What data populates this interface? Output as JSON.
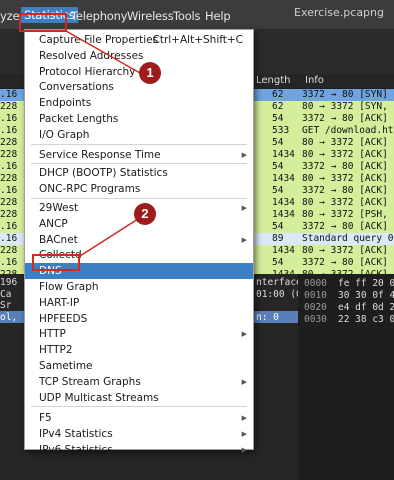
{
  "window": {
    "title": "Exercise.pcapng"
  },
  "menubar": {
    "items": [
      "yze",
      "Statistics",
      "Telephony",
      "Wireless",
      "Tools",
      "Help"
    ]
  },
  "packet_list": {
    "col_length": "Length",
    "col_info": "Info",
    "rows": [
      {
        "left": ".16",
        "len": "62",
        "info": "3372 → 80 [SYN]",
        "color": "#6fa4e0"
      },
      {
        "left": "228",
        "len": "62",
        "info": "80 → 3372 [SYN,",
        "color": "#d4ee9c"
      },
      {
        "left": ".16",
        "len": "54",
        "info": "3372 → 80 [ACK]",
        "color": "#d4ee9c"
      },
      {
        "left": ".16",
        "len": "533",
        "info": "GET /download.ht",
        "color": "#d4ee9c"
      },
      {
        "left": "228",
        "len": "54",
        "info": "80 → 3372 [ACK]",
        "color": "#d4ee9c"
      },
      {
        "left": "228",
        "len": "1434",
        "info": "80 → 3372 [ACK]",
        "color": "#d4ee9c"
      },
      {
        "left": ".16",
        "len": "54",
        "info": "3372 → 80 [ACK]",
        "color": "#d4ee9c"
      },
      {
        "left": "228",
        "len": "1434",
        "info": "80 → 3372 [ACK]",
        "color": "#d4ee9c"
      },
      {
        "left": ".16",
        "len": "54",
        "info": "3372 → 80 [ACK]",
        "color": "#d4ee9c"
      },
      {
        "left": "228",
        "len": "1434",
        "info": "80 → 3372 [ACK]",
        "color": "#d4ee9c"
      },
      {
        "left": "228",
        "len": "1434",
        "info": "80 → 3372 [PSH,",
        "color": "#d4ee9c"
      },
      {
        "left": ".16",
        "len": "54",
        "info": "3372 → 80 [ACK]",
        "color": "#d4ee9c"
      },
      {
        "left": ".16",
        "len": "89",
        "info": "Standard query 0",
        "color": "#dae8f8"
      },
      {
        "left": "228",
        "len": "1434",
        "info": "80 → 3372 [ACK]",
        "color": "#d4ee9c"
      },
      {
        "left": ".16",
        "len": "54",
        "info": "3372 → 80 [ACK]",
        "color": "#d4ee9c"
      },
      {
        "left": "228",
        "len": "1434",
        "info": "80 → 3372 [ACK]",
        "color": "#d4ee9c"
      }
    ]
  },
  "details": {
    "lines": [
      {
        "left": "196",
        "right": "nterface"
      },
      {
        "left": "Ca",
        "right": "01:00 (0"
      },
      {
        "left": "Sr",
        "right": ""
      },
      {
        "left": "ol,",
        "right": "n: 0"
      }
    ]
  },
  "bytes_pane": {
    "rows": [
      {
        "off": "0000",
        "hex": "fe ff 20 0"
      },
      {
        "off": "0010",
        "hex": "30 30 0f 4"
      },
      {
        "off": "0020",
        "hex": "e4 df 0d 2"
      },
      {
        "off": "0030",
        "hex": "22 38 c3 0"
      }
    ]
  },
  "statistics_menu": {
    "items": [
      {
        "label": "Capture File Properties",
        "shortcut": "Ctrl+Alt+Shift+C",
        "submenu": false
      },
      {
        "label": "Resolved Addresses",
        "shortcut": "",
        "submenu": false
      },
      {
        "label": "Protocol Hierarchy",
        "shortcut": "",
        "submenu": false
      },
      {
        "label": "Conversations",
        "shortcut": "",
        "submenu": false
      },
      {
        "label": "Endpoints",
        "shortcut": "",
        "submenu": false
      },
      {
        "label": "Packet Lengths",
        "shortcut": "",
        "submenu": false
      },
      {
        "label": "I/O Graph",
        "shortcut": "",
        "submenu": false
      },
      {
        "label": "Service Response Time",
        "shortcut": "",
        "submenu": true
      },
      {
        "label": "DHCP (BOOTP) Statistics",
        "shortcut": "",
        "submenu": false
      },
      {
        "label": "ONC-RPC Programs",
        "shortcut": "",
        "submenu": false
      },
      {
        "label": "29West",
        "shortcut": "",
        "submenu": true
      },
      {
        "label": "ANCP",
        "shortcut": "",
        "submenu": false
      },
      {
        "label": "BACnet",
        "shortcut": "",
        "submenu": true
      },
      {
        "label": "Collectd",
        "shortcut": "",
        "submenu": false
      },
      {
        "label": "DNS",
        "shortcut": "",
        "submenu": false
      },
      {
        "label": "Flow Graph",
        "shortcut": "",
        "submenu": false
      },
      {
        "label": "HART-IP",
        "shortcut": "",
        "submenu": false
      },
      {
        "label": "HPFEEDS",
        "shortcut": "",
        "submenu": false
      },
      {
        "label": "HTTP",
        "shortcut": "",
        "submenu": true
      },
      {
        "label": "HTTP2",
        "shortcut": "",
        "submenu": false
      },
      {
        "label": "Sametime",
        "shortcut": "",
        "submenu": false
      },
      {
        "label": "TCP Stream Graphs",
        "shortcut": "",
        "submenu": true
      },
      {
        "label": "UDP Multicast Streams",
        "shortcut": "",
        "submenu": false
      },
      {
        "label": "F5",
        "shortcut": "",
        "submenu": true
      },
      {
        "label": "IPv4 Statistics",
        "shortcut": "",
        "submenu": true
      },
      {
        "label": "IPv6 Statistics",
        "shortcut": "",
        "submenu": true
      }
    ],
    "highlighted": "DNS"
  },
  "annotations": {
    "badge1": "1",
    "badge2": "2",
    "color": "#d3281e"
  }
}
